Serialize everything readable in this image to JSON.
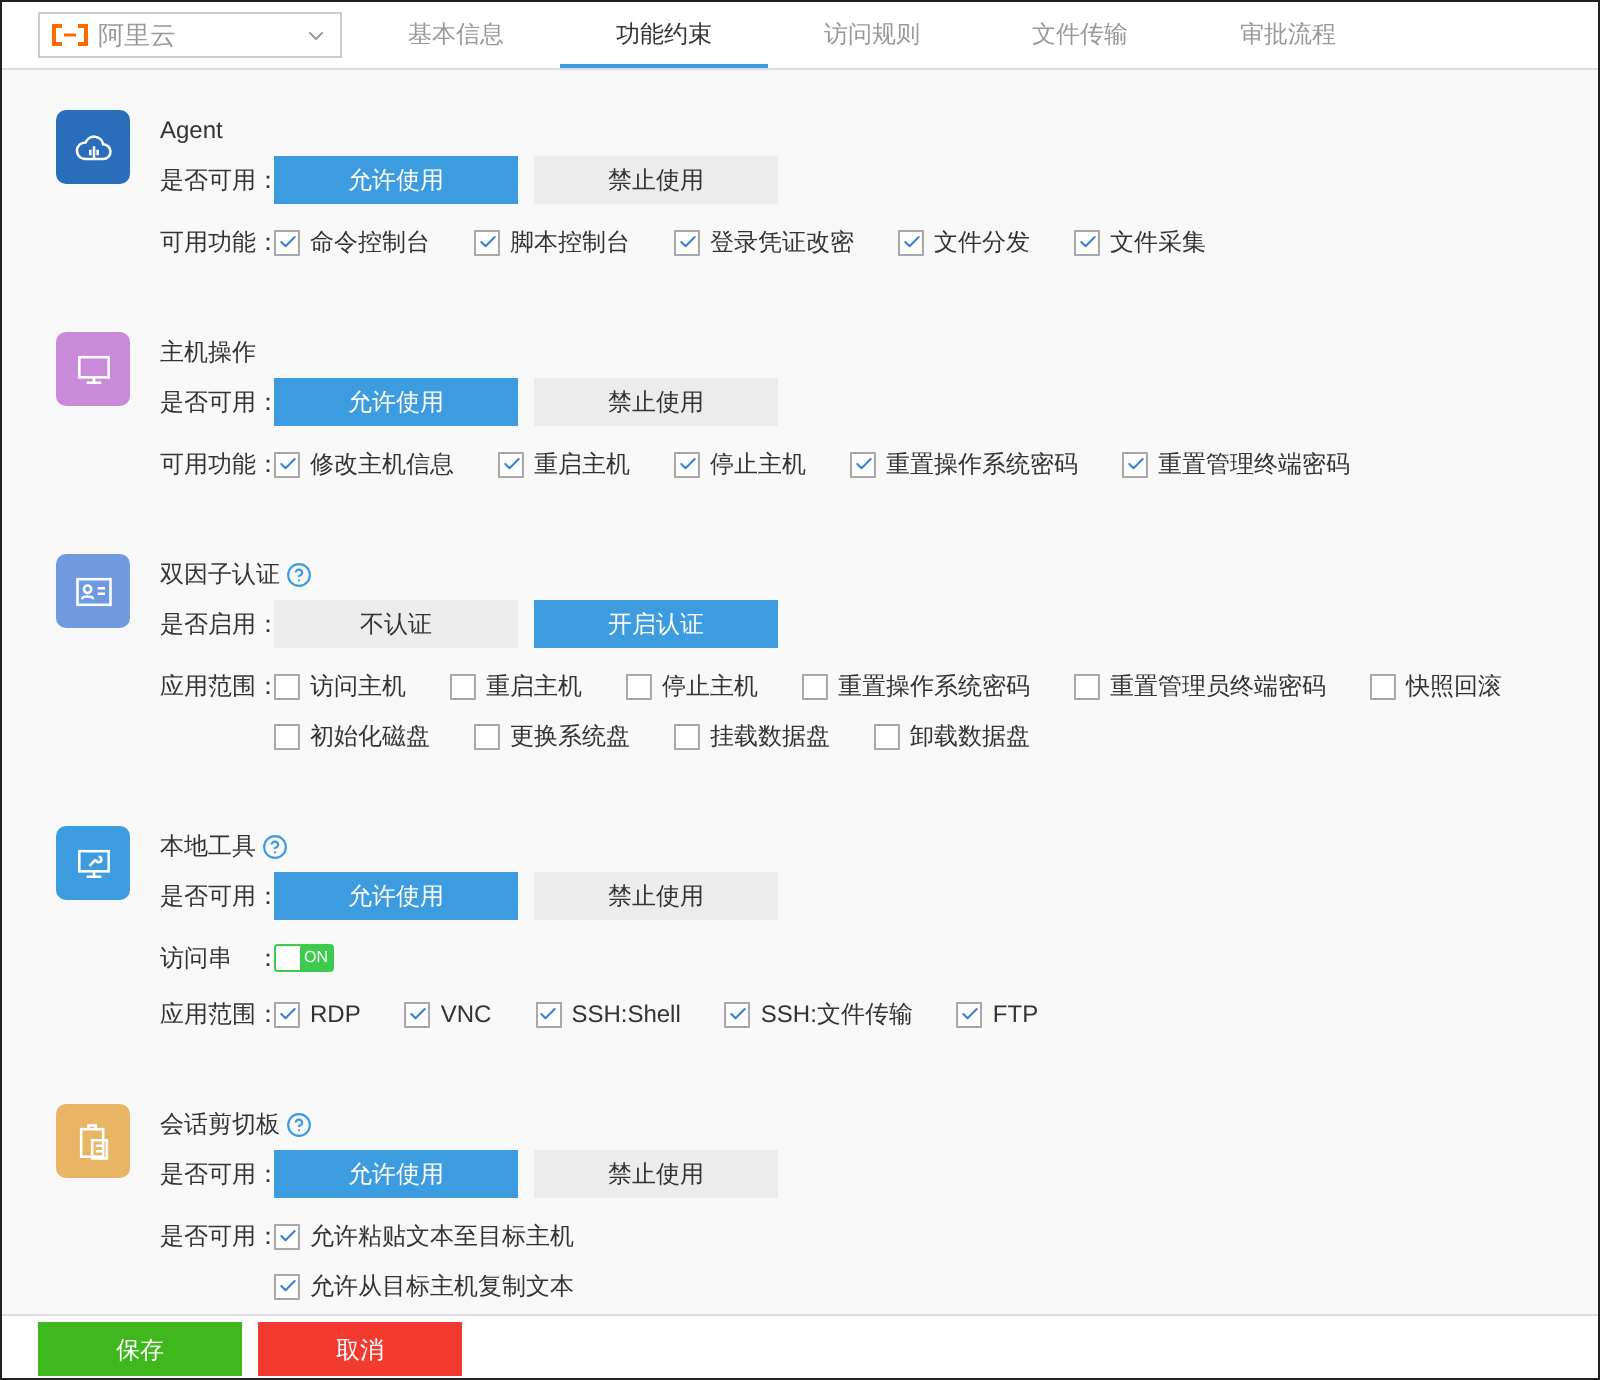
{
  "cloud_select": {
    "value": "阿里云"
  },
  "tabs": [
    {
      "label": "基本信息",
      "selected": false
    },
    {
      "label": "功能约束",
      "selected": true
    },
    {
      "label": "访问规则",
      "selected": false
    },
    {
      "label": "文件传输",
      "selected": false
    },
    {
      "label": "审批流程",
      "selected": false
    }
  ],
  "sections": [
    {
      "title": "Agent",
      "help_icon": false,
      "color": "#2a6ebb",
      "rows": [
        {
          "kind": "choice",
          "label": "是否可用：",
          "options": [
            {
              "label": "允许使用",
              "selected": true
            },
            {
              "label": "禁止使用",
              "selected": false
            }
          ]
        },
        {
          "kind": "checks",
          "label": "可用功能：",
          "lines": [
            [
              {
                "label": "命令控制台",
                "checked": true
              },
              {
                "label": "脚本控制台",
                "checked": true
              },
              {
                "label": "登录凭证改密",
                "checked": true
              },
              {
                "label": "文件分发",
                "checked": true
              },
              {
                "label": "文件采集",
                "checked": true
              }
            ]
          ]
        }
      ]
    },
    {
      "title": "主机操作",
      "help_icon": false,
      "color": "#c98ad9",
      "rows": [
        {
          "kind": "choice",
          "label": "是否可用：",
          "options": [
            {
              "label": "允许使用",
              "selected": true
            },
            {
              "label": "禁止使用",
              "selected": false
            }
          ]
        },
        {
          "kind": "checks",
          "label": "可用功能：",
          "lines": [
            [
              {
                "label": "修改主机信息",
                "checked": true
              },
              {
                "label": "重启主机",
                "checked": true
              },
              {
                "label": "停止主机",
                "checked": true
              },
              {
                "label": "重置操作系统密码",
                "checked": true
              },
              {
                "label": "重置管理终端密码",
                "checked": true
              }
            ]
          ]
        }
      ]
    },
    {
      "title": "双因子认证",
      "help_icon": true,
      "color": "#6f9ae0",
      "rows": [
        {
          "kind": "choice",
          "label": "是否启用：",
          "options": [
            {
              "label": "不认证",
              "selected": false
            },
            {
              "label": "开启认证",
              "selected": true
            }
          ]
        },
        {
          "kind": "checks",
          "label": "应用范围：",
          "lines": [
            [
              {
                "label": "访问主机",
                "checked": false
              },
              {
                "label": "重启主机",
                "checked": false
              },
              {
                "label": "停止主机",
                "checked": false
              },
              {
                "label": "重置操作系统密码",
                "checked": false
              },
              {
                "label": "重置管理员终端密码",
                "checked": false
              },
              {
                "label": "快照回滚",
                "checked": false
              }
            ],
            [
              {
                "label": "初始化磁盘",
                "checked": false
              },
              {
                "label": "更换系统盘",
                "checked": false
              },
              {
                "label": "挂载数据盘",
                "checked": false
              },
              {
                "label": "卸载数据盘",
                "checked": false
              }
            ]
          ]
        }
      ]
    },
    {
      "title": "本地工具",
      "help_icon": true,
      "color": "#3d9be0",
      "rows": [
        {
          "kind": "choice",
          "label": "是否可用：",
          "options": [
            {
              "label": "允许使用",
              "selected": true
            },
            {
              "label": "禁止使用",
              "selected": false
            }
          ]
        },
        {
          "kind": "toggle",
          "label": "访问串　：",
          "on": true,
          "text": "ON"
        },
        {
          "kind": "checks",
          "label": "应用范围：",
          "lines": [
            [
              {
                "label": "RDP",
                "checked": true
              },
              {
                "label": "VNC",
                "checked": true
              },
              {
                "label": "SSH:Shell",
                "checked": true
              },
              {
                "label": "SSH:文件传输",
                "checked": true
              },
              {
                "label": "FTP",
                "checked": true
              }
            ]
          ]
        }
      ]
    },
    {
      "title": "会话剪切板",
      "help_icon": true,
      "color": "#e8b465",
      "rows": [
        {
          "kind": "choice",
          "label": "是否可用：",
          "options": [
            {
              "label": "允许使用",
              "selected": true
            },
            {
              "label": "禁止使用",
              "selected": false
            }
          ]
        },
        {
          "kind": "checks",
          "label": "是否可用：",
          "lines": [
            [
              {
                "label": "允许粘贴文本至目标主机",
                "checked": true
              }
            ],
            [
              {
                "label": "允许从目标主机复制文本",
                "checked": true
              }
            ]
          ]
        }
      ]
    }
  ],
  "footer": {
    "save": "保存",
    "cancel": "取消"
  }
}
